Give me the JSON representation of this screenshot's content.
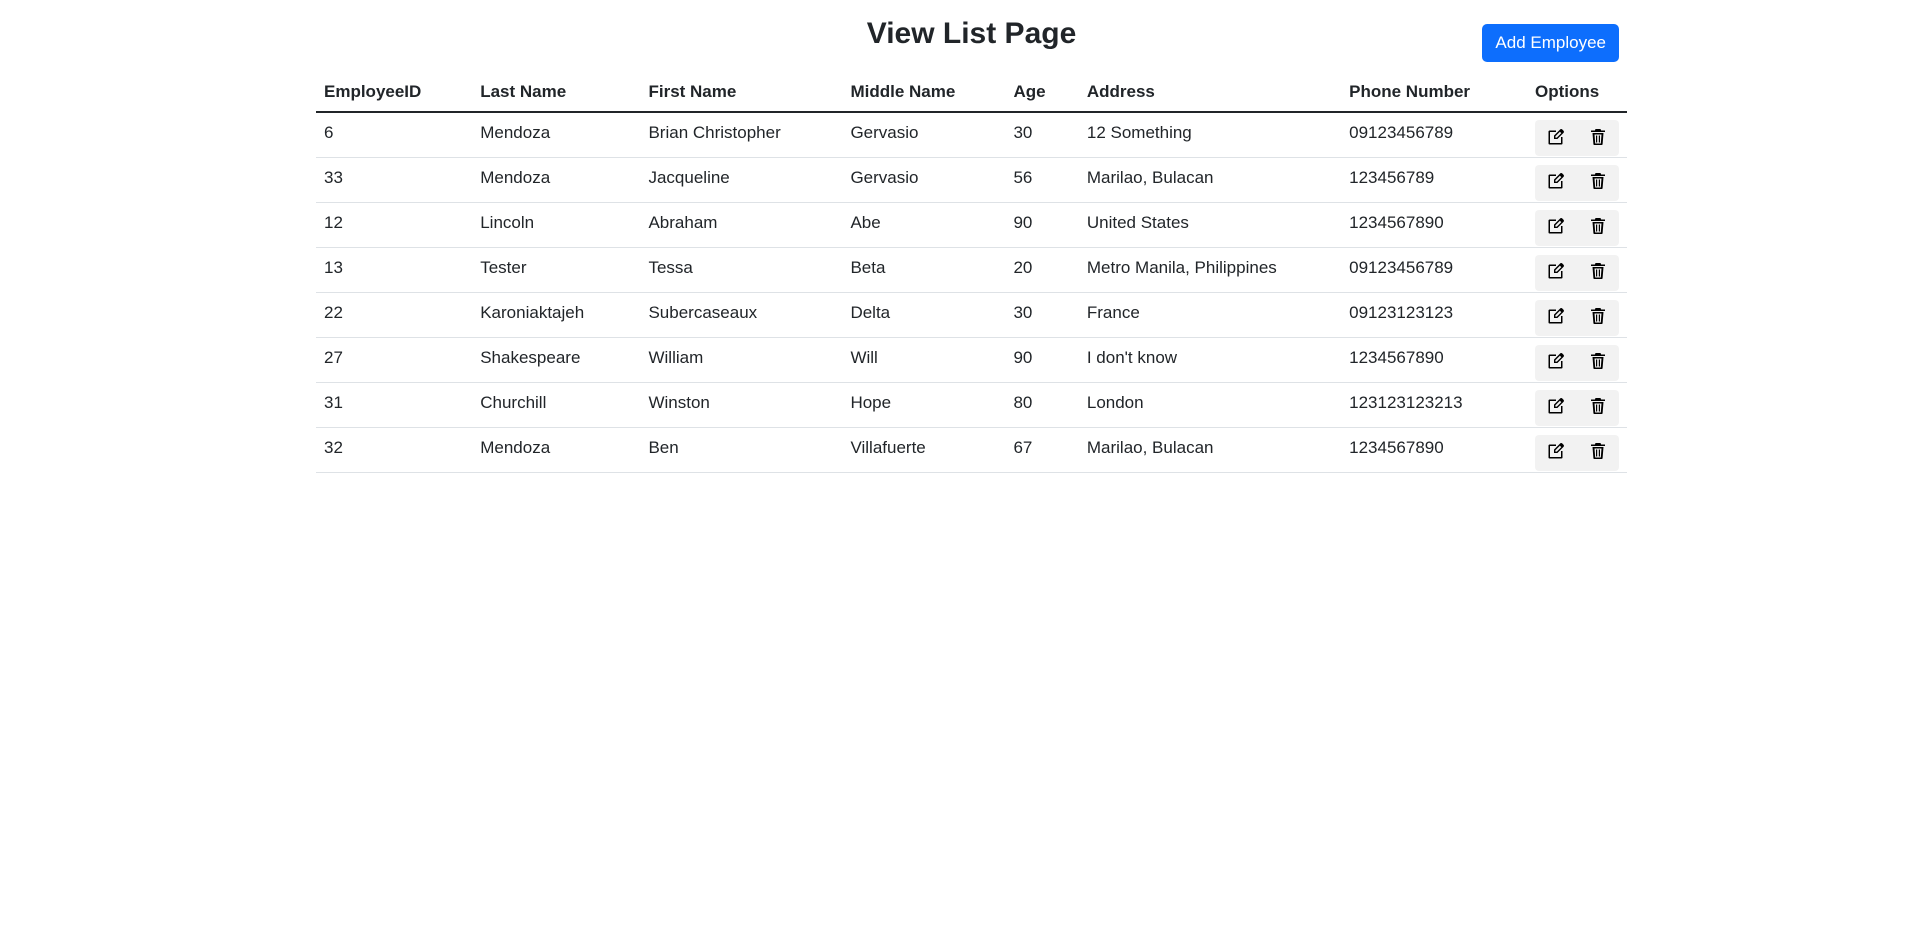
{
  "page": {
    "title": "View List Page",
    "add_button_label": "Add Employee"
  },
  "table": {
    "headers": [
      "EmployeeID",
      "Last Name",
      "First Name",
      "Middle Name",
      "Age",
      "Address",
      "Phone Number",
      "Options"
    ],
    "rows": [
      {
        "id": "6",
        "last": "Mendoza",
        "first": "Brian Christopher",
        "middle": "Gervasio",
        "age": "30",
        "address": "12 Something",
        "phone": "09123456789"
      },
      {
        "id": "33",
        "last": "Mendoza",
        "first": "Jacqueline",
        "middle": "Gervasio",
        "age": "56",
        "address": "Marilao, Bulacan",
        "phone": "123456789"
      },
      {
        "id": "12",
        "last": "Lincoln",
        "first": "Abraham",
        "middle": "Abe",
        "age": "90",
        "address": "United States",
        "phone": "1234567890"
      },
      {
        "id": "13",
        "last": "Tester",
        "first": "Tessa",
        "middle": "Beta",
        "age": "20",
        "address": "Metro Manila, Philippines",
        "phone": "09123456789"
      },
      {
        "id": "22",
        "last": "Karoniaktajeh",
        "first": "Subercaseaux",
        "middle": "Delta",
        "age": "30",
        "address": "France",
        "phone": "09123123123"
      },
      {
        "id": "27",
        "last": "Shakespeare",
        "first": "William",
        "middle": "Will",
        "age": "90",
        "address": "I don't know",
        "phone": "1234567890"
      },
      {
        "id": "31",
        "last": "Churchill",
        "first": "Winston",
        "middle": "Hope",
        "age": "80",
        "address": "London",
        "phone": "123123123213"
      },
      {
        "id": "32",
        "last": "Mendoza",
        "first": "Ben",
        "middle": "Villafuerte",
        "age": "67",
        "address": "Marilao, Bulacan",
        "phone": "1234567890"
      }
    ],
    "row_actions": {
      "edit_icon": "edit-icon",
      "delete_icon": "trash-icon"
    }
  },
  "colors": {
    "primary_button": "#0d6efd",
    "action_button_bg": "#f2f2f2"
  }
}
